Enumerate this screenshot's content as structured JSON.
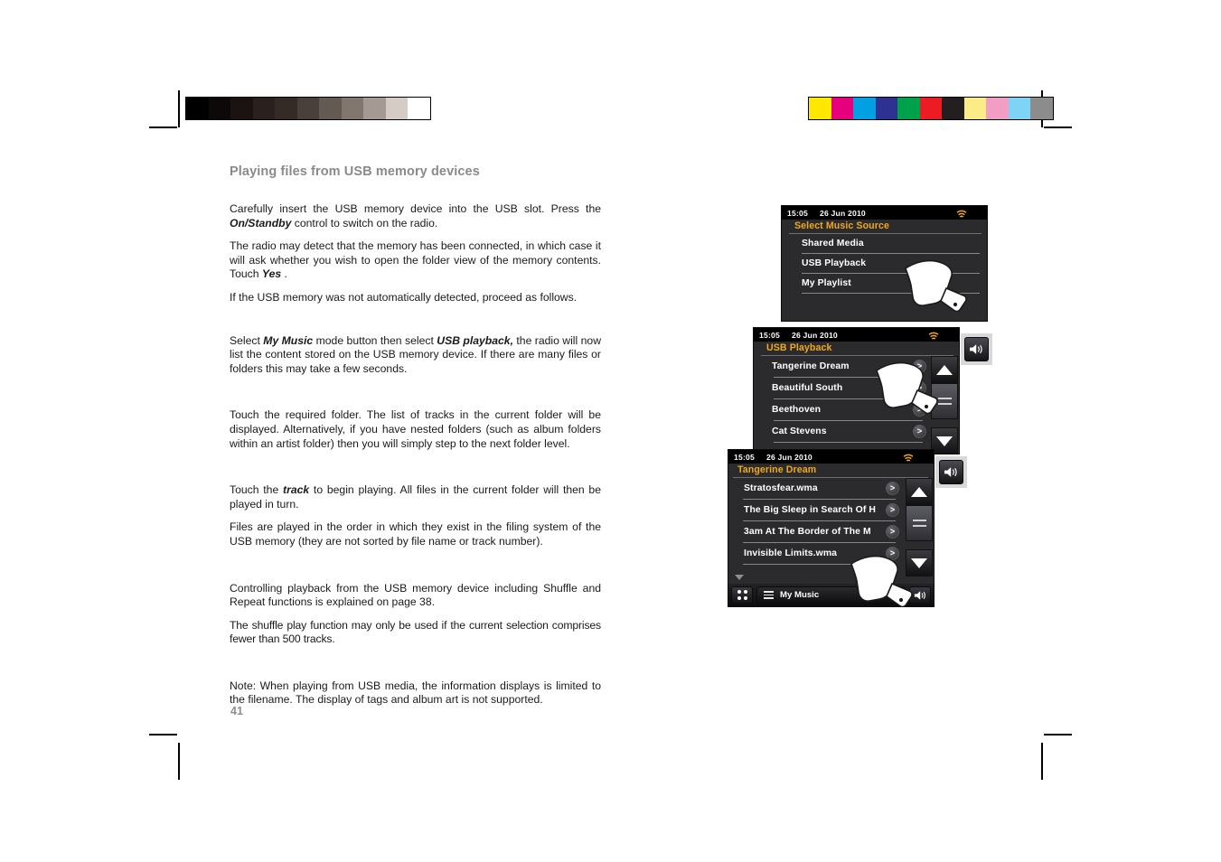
{
  "page": {
    "heading": "Playing files from USB memory devices",
    "number": "41"
  },
  "paragraphs": {
    "p1_a": "Carefully insert the USB memory device into the USB slot. Press the ",
    "p1_b": "On/Standby",
    "p1_c": " control to switch on the radio.",
    "p2_a": "The radio may detect that the memory has been connected, in which case it will ask whether you wish to open the folder view of the memory contents. Touch ",
    "p2_b": "Yes",
    "p2_c": " .",
    "p3": "If the USB memory was not automatically detected, proceed as follows.",
    "p4_a": "Select ",
    "p4_b": "My Music",
    "p4_c": " mode button then select ",
    "p4_d": "USB playback,",
    "p4_e": " the radio will now list the content stored on the USB memory device. If there are many files or folders this may take a few seconds.",
    "p5": "Touch the required folder. The list of tracks in the current folder will be displayed.  Alternatively, if you have nested folders (such as album folders within an artist folder) then you will simply step to the next folder level.",
    "p6_a": "Touch the ",
    "p6_b": "track",
    "p6_c": " to begin playing.  All files in the current folder will then be played in turn.",
    "p7": "Files are played in the order in which they exist in the filing system of the USB memory (they are not sorted by file name or track number).",
    "p8": "Controlling playback from the USB memory device including Shuffle and Repeat functions is explained on page 38.",
    "p9": "The shuffle play function may only be used if the current selection comprises fewer than 500 tracks.",
    "p10": "Note: When playing from USB media, the information displays is limited to the filename. The display of tags and album art is not supported."
  },
  "calibration": {
    "gray_swatches": [
      "#000000",
      "#0d0908",
      "#1a1311",
      "#2a211e",
      "#342a26",
      "#49403b",
      "#635a54",
      "#81776f",
      "#a49a93",
      "#d6ccc6",
      "#ffffff"
    ],
    "color_swatches": [
      "#ffe800",
      "#e6007e",
      "#00a0e3",
      "#2e3192",
      "#00a14b",
      "#ed1c24",
      "#231f20",
      "#fbec87",
      "#f29ec4",
      "#7fd4f5",
      "#8c8c8c"
    ]
  },
  "screens": [
    {
      "id": "select-music-source",
      "status": {
        "time": "15:05",
        "date": "26 Jun 2010",
        "wifi_icon": "wifi-icon"
      },
      "title": "Select Music Source",
      "items": [
        {
          "label": "Shared Media",
          "chevron": false
        },
        {
          "label": "USB Playback",
          "chevron": false
        },
        {
          "label": "My Playlist",
          "chevron": false
        }
      ]
    },
    {
      "id": "usb-playback",
      "status": {
        "time": "15:05",
        "date": "26 Jun 2010",
        "wifi_icon": "wifi-icon"
      },
      "title": "USB Playback",
      "items": [
        {
          "label": "Tangerine Dream",
          "chevron": true
        },
        {
          "label": "Beautiful South",
          "chevron": true
        },
        {
          "label": "Beethoven",
          "chevron": true
        },
        {
          "label": "Cat Stevens",
          "chevron": true
        }
      ],
      "chevron_glyph": ">",
      "rail": {
        "up_icon": "triangle-up-icon",
        "menu_icon": "hamburger-menu-icon",
        "down_icon": "triangle-down-icon"
      },
      "volume_icon": "speaker-volume-icon"
    },
    {
      "id": "tangerine-dream",
      "status": {
        "time": "15:05",
        "date": "26 Jun 2010",
        "wifi_icon": "wifi-icon"
      },
      "title": "Tangerine Dream",
      "items": [
        {
          "label": "Stratosfear.wma",
          "chevron": true
        },
        {
          "label": "The Big Sleep in Search Of H",
          "chevron": true
        },
        {
          "label": "3am At The Border of The M",
          "chevron": true
        },
        {
          "label": "Invisible Limits.wma",
          "chevron": true
        }
      ],
      "chevron_glyph": ">",
      "rail": {
        "up_icon": "triangle-up-icon",
        "menu_icon": "hamburger-menu-icon",
        "down_icon": "triangle-down-icon"
      },
      "volume_icon": "speaker-volume-icon",
      "bottom_bar": {
        "grid_icon": "grid-dots-icon",
        "menu_icon": "hamburger-menu-icon",
        "label": "My Music",
        "volume_icon": "speaker-volume-icon"
      }
    }
  ]
}
